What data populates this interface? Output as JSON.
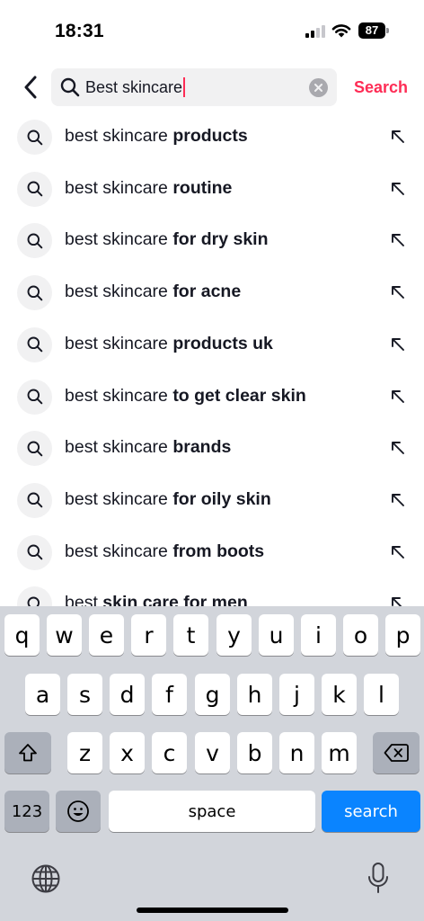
{
  "status_bar": {
    "time": "18:31",
    "battery": "87",
    "icons": [
      "signal-icon",
      "wifi-icon",
      "battery-icon"
    ]
  },
  "header": {
    "back_icon": "chevron-left-icon",
    "search_query": "Best skincare",
    "clear_icon": "clear-icon",
    "search_button": "Search"
  },
  "suggestions": [
    {
      "prefix": "best skincare ",
      "suffix": "products"
    },
    {
      "prefix": "best skincare ",
      "suffix": "routine"
    },
    {
      "prefix": "best skincare ",
      "suffix": "for dry skin"
    },
    {
      "prefix": "best skincare ",
      "suffix": "for acne"
    },
    {
      "prefix": "best skincare ",
      "suffix": "products uk"
    },
    {
      "prefix": "best skincare ",
      "suffix": "to get clear skin"
    },
    {
      "prefix": "best skincare ",
      "suffix": "brands"
    },
    {
      "prefix": "best skincare ",
      "suffix": "for oily skin"
    },
    {
      "prefix": "best skincare ",
      "suffix": "from boots"
    },
    {
      "prefix": "best ",
      "suffix": "skin care for men"
    }
  ],
  "keyboard": {
    "row1": [
      "q",
      "w",
      "e",
      "r",
      "t",
      "y",
      "u",
      "i",
      "o",
      "p"
    ],
    "row2": [
      "a",
      "s",
      "d",
      "f",
      "g",
      "h",
      "j",
      "k",
      "l"
    ],
    "row3": [
      "z",
      "x",
      "c",
      "v",
      "b",
      "n",
      "m"
    ],
    "numbers_key": "123",
    "space_key": "space",
    "search_key": "search",
    "icons": [
      "shift-icon",
      "backspace-icon",
      "emoji-icon",
      "globe-icon",
      "microphone-icon"
    ]
  },
  "colors": {
    "accent": "#fe2c55",
    "keyboard_action": "#0a84ff",
    "keyboard_background": "#d2d5db"
  }
}
